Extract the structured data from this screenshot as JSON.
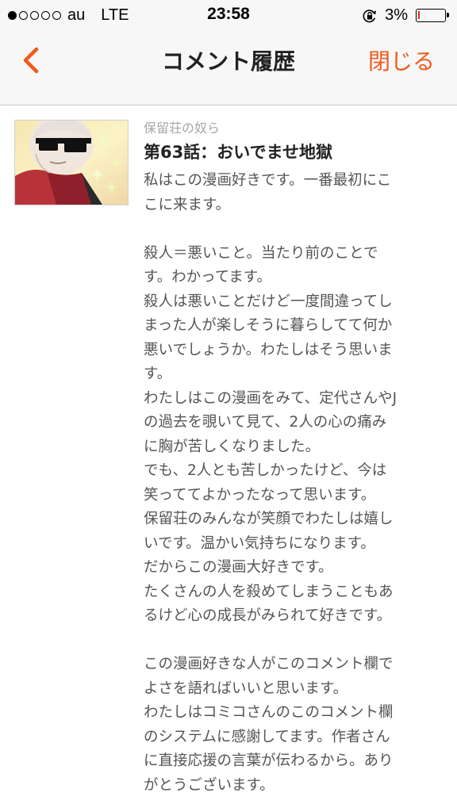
{
  "status_bar": {
    "signal_dots_filled": 1,
    "signal_dots_total": 5,
    "carrier": "au",
    "network": "LTE",
    "time": "23:58",
    "battery_text": "3%",
    "battery_level": 0.03,
    "battery_color": "#e0281c",
    "icons": [
      "orientation-lock-icon",
      "battery-icon"
    ]
  },
  "nav": {
    "back_icon": "chevron-left-icon",
    "title": "コメント履歴",
    "close_label": "閉じる",
    "accent_color": "#ef5a1c"
  },
  "comment": {
    "series_name": "保留荘の奴ら",
    "episode_title": "第63話：おいでませ地獄",
    "body_lines": [
      "私はこの漫画好きです。一番最初にこ",
      "こに来ます。",
      "",
      "殺人＝悪いこと。当たり前のことで",
      "す。わかってます。",
      "殺人は悪いことだけど一度間違ってし",
      "まった人が楽しそうに暮らしてて何か",
      "悪いでしょうか。わたしはそう思いま",
      "す。",
      "わたしはこの漫画をみて、定代さんやJ",
      "の過去を覗いて見て、2人の心の痛み",
      "に胸が苦しくなりました。",
      "でも、2人とも苦しかったけど、今は",
      "笑っててよかったなって思います。",
      "保留荘のみんなが笑顔でわたしは嬉し",
      "いです。温かい気持ちになります。",
      "だからこの漫画大好きです。",
      "たくさんの人を殺めてしまうこともあ",
      "るけど心の成長がみられて好きです。",
      "",
      "この漫画好きな人がこのコメント欄で",
      "よさを語ればいいと思います。",
      "わたしはコミコさんのこのコメント欄",
      "のシステムに感謝してます。作者さん",
      "に直接応援の言葉が伝わるから。あり",
      "がとうございます。"
    ]
  }
}
